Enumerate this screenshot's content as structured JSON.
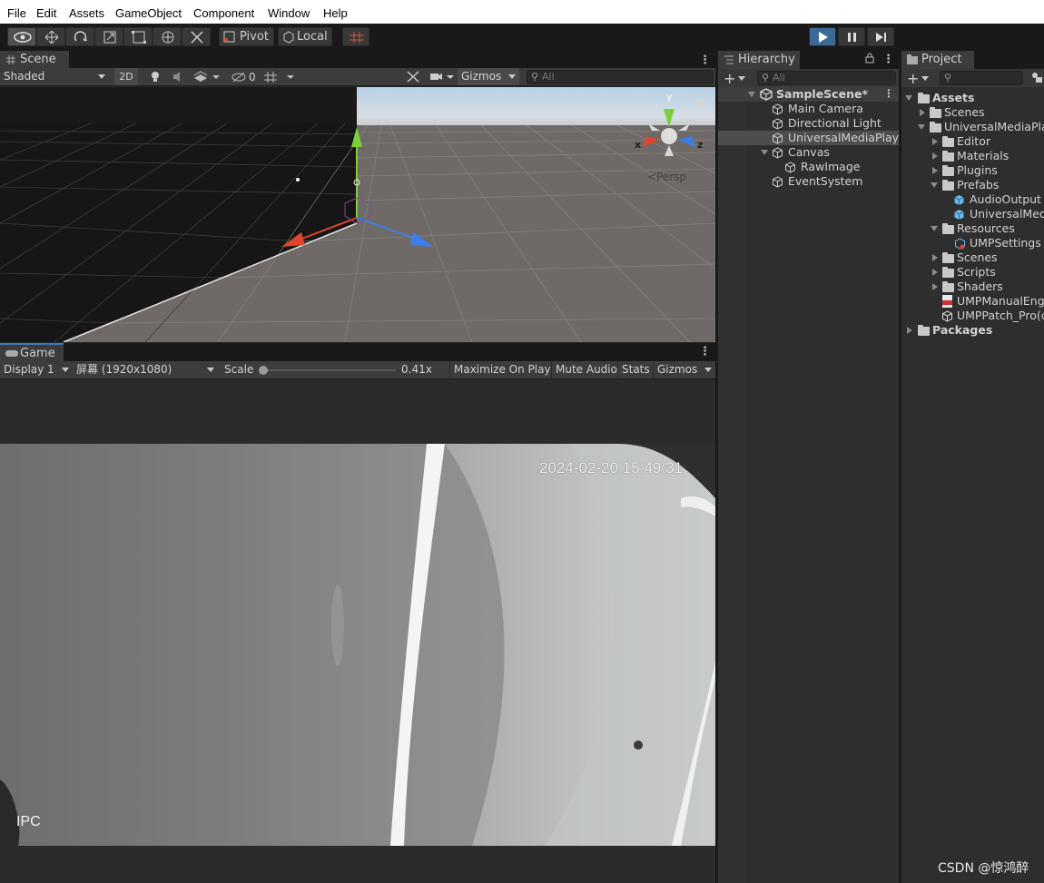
{
  "menu": [
    "File",
    "Edit",
    "Assets",
    "GameObject",
    "Component",
    "Window",
    "Help"
  ],
  "toolbar": {
    "pivot": "Pivot",
    "local": "Local",
    "play_active": true
  },
  "scene": {
    "tab": "Scene",
    "shading": "Shaded",
    "mode2d": "2D",
    "hidden_count": "0",
    "gizmos": "Gizmos",
    "search_placeholder": "All",
    "persp": "Persp",
    "axis_x": "x",
    "axis_y": "y",
    "axis_z": "z"
  },
  "game": {
    "tab": "Game",
    "display": "Display 1",
    "resolution": "屏幕 (1920x1080)",
    "scale_label": "Scale",
    "scale_value": "0.41x",
    "maximize": "Maximize On Play",
    "mute": "Mute Audio",
    "stats": "Stats",
    "gizmos": "Gizmos",
    "timestamp": "2024-02-20 15:49:31",
    "watermark": "IPC"
  },
  "hierarchy": {
    "tab": "Hierarchy",
    "search_placeholder": "All",
    "scene_name": "SampleScene*",
    "items": [
      "Main Camera",
      "Directional Light",
      "UniversalMediaPlaye",
      "Canvas",
      "RawImage",
      "EventSystem"
    ]
  },
  "project": {
    "tab": "Project",
    "items": [
      "Assets",
      "Scenes",
      "UniversalMediaPlay",
      "Editor",
      "Materials",
      "Plugins",
      "Prefabs",
      "AudioOutput",
      "UniversalMedi",
      "Resources",
      "UMPSettings",
      "Scenes",
      "Scripts",
      "Shaders",
      "UMPManualEng",
      "UMPPatch_Pro(c",
      "Packages"
    ]
  },
  "watermark": "CSDN @惊鸿醉",
  "colors": {
    "axis_x": "#e0442c",
    "axis_y": "#7ad13a",
    "axis_z": "#3b7ee8",
    "play_active": "#3a6a9a",
    "selection": "#4d4d4d"
  }
}
